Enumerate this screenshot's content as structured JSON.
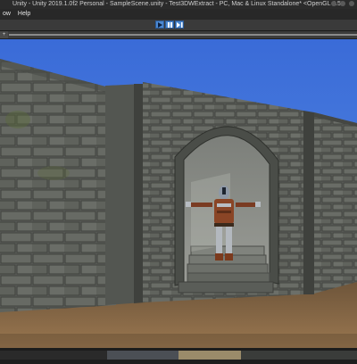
{
  "window": {
    "title": "Unity - Unity 2019.1.0f2 Personal - SampleScene.unity - Test3DWExtract - PC, Mac & Linux Standalone* <OpenGL 4.5>"
  },
  "menu": {
    "items": [
      {
        "label": "ow"
      },
      {
        "label": "Help"
      }
    ]
  },
  "toolbar": {
    "play_icon": "play-icon",
    "pause_icon": "pause-icon",
    "step_icon": "step-icon",
    "accent": "#4c88d0"
  },
  "tabs": {
    "game_tab_glyph": "+"
  },
  "scene": {
    "sky_color": "#3f6fd6",
    "stone_color": "#5f615c",
    "ground_color": "#8a6a44",
    "character": "armored-knight"
  }
}
